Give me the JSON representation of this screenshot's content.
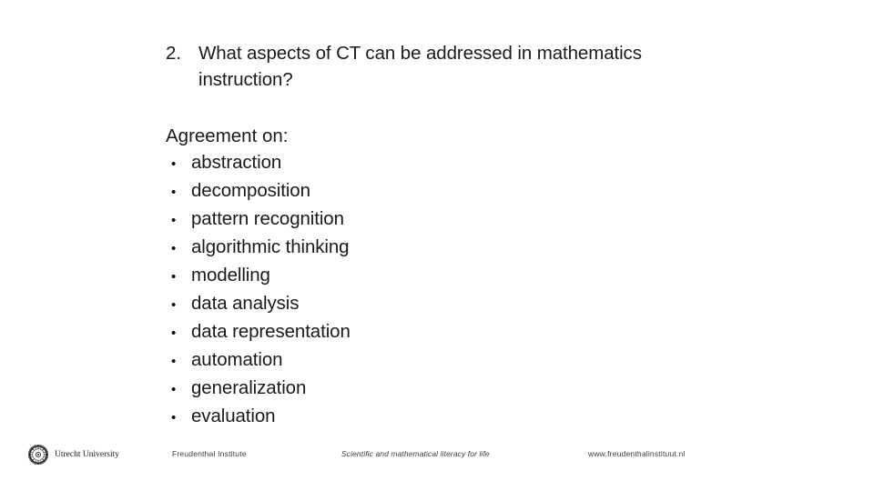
{
  "slide": {
    "background_color": "#ffffff",
    "text_color": "#1a1a1a"
  },
  "question": {
    "number": "2.",
    "line1": "What aspects of CT can be addressed in mathematics",
    "line2": "instruction?"
  },
  "agreement": {
    "heading": "Agreement on:",
    "bullet_glyph": "•",
    "items": [
      "abstraction",
      "decomposition",
      "pattern recognition",
      "algorithmic thinking",
      "modelling",
      "data analysis",
      "data representation",
      "automation",
      "generalization",
      "evaluation"
    ]
  },
  "footer": {
    "logo_icon": "utrecht-university-sun-emblem",
    "logo_text": "Utrecht University",
    "institute": "Freudenthal Institute",
    "tagline": "Scientific and mathematical literacy for life",
    "url": "www.freudenthalinstituut.nl"
  }
}
